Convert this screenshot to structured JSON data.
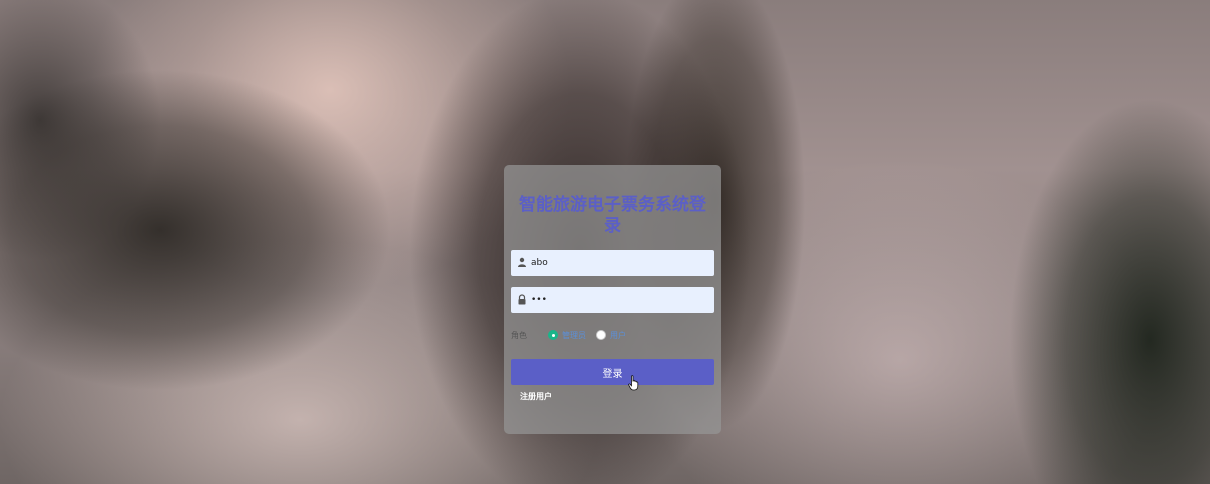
{
  "form": {
    "title": "智能旅游电子票务系统登录",
    "username_value": "abo",
    "password_value": "•••",
    "role_label": "角色",
    "role_options": [
      "管理员",
      "用户"
    ],
    "role_selected": "管理员",
    "login_label": "登录",
    "register_label": "注册用户"
  },
  "icons": {
    "username": "user-icon",
    "password": "lock-icon",
    "pointer": "hand-cursor-icon"
  },
  "colors": {
    "accent": "#5b5fc7",
    "radio_checked": "#19b58a",
    "input_bg": "#e8f0fe"
  }
}
